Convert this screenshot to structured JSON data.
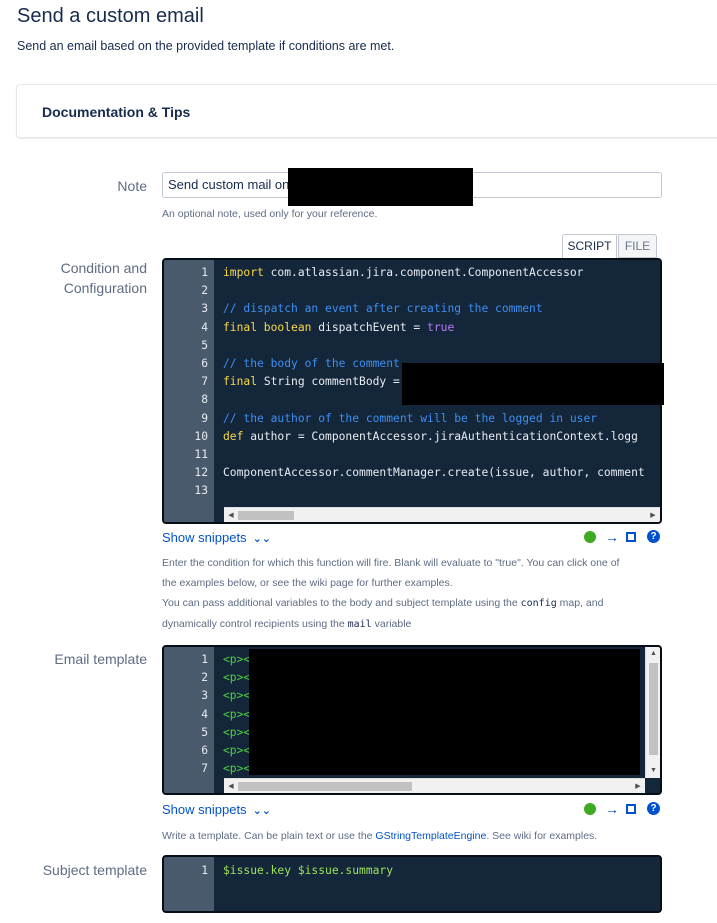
{
  "header": {
    "title": "Send a custom email",
    "description": "Send an email based on the provided template if conditions are met."
  },
  "doc_panel": {
    "title": "Documentation & Tips"
  },
  "note": {
    "label": "Note",
    "value": "Send custom mail on",
    "help": "An optional note, used only for your reference."
  },
  "condition": {
    "label_line1": "Condition and",
    "label_line2": "Configuration",
    "tabs": {
      "script": "SCRIPT",
      "file": "FILE"
    },
    "lines": [
      {
        "n": "1",
        "tokens": [
          {
            "t": "import ",
            "c": "kw"
          },
          {
            "t": "com.atlassian.jira.component.ComponentAccessor",
            "c": "pl"
          }
        ]
      },
      {
        "n": "2",
        "tokens": []
      },
      {
        "n": "3",
        "tokens": [
          {
            "t": "// dispatch an event after creating the comment",
            "c": "cm"
          }
        ]
      },
      {
        "n": "4",
        "tokens": [
          {
            "t": "final boolean ",
            "c": "kw"
          },
          {
            "t": "dispatchEvent = ",
            "c": "pl"
          },
          {
            "t": "true",
            "c": "bo"
          }
        ]
      },
      {
        "n": "5",
        "tokens": []
      },
      {
        "n": "6",
        "tokens": [
          {
            "t": "// the body of the comment",
            "c": "cm"
          }
        ]
      },
      {
        "n": "7",
        "tokens": [
          {
            "t": "final ",
            "c": "kw"
          },
          {
            "t": "String commentBody =",
            "c": "pl"
          }
        ]
      },
      {
        "n": "8",
        "tokens": []
      },
      {
        "n": "9",
        "tokens": [
          {
            "t": "// the author of the comment will be the logged in user",
            "c": "cm"
          }
        ]
      },
      {
        "n": "10",
        "tokens": [
          {
            "t": "def ",
            "c": "kw"
          },
          {
            "t": "author = ComponentAccessor.jiraAuthenticationContext.logg",
            "c": "pl"
          }
        ]
      },
      {
        "n": "11",
        "tokens": []
      },
      {
        "n": "12",
        "tokens": [
          {
            "t": "ComponentAccessor.commentManager.create(issue, author, comment",
            "c": "pl"
          }
        ]
      },
      {
        "n": "13",
        "tokens": []
      }
    ],
    "snippets_label": "Show snippets",
    "help_1": "Enter the condition for which this function will fire. Blank will evaluate to \"true\". You can click one of",
    "help_2": "the examples below, or see the wiki page for further examples.",
    "help_3a": "You can pass additional variables to the body and subject template using the ",
    "help_3_code": "config",
    "help_3b": " map, and",
    "help_4a": "dynamically control recipients using the ",
    "help_4_code": "mail",
    "help_4b": " variable"
  },
  "email_template": {
    "label": "Email template",
    "lines": [
      {
        "n": "1",
        "tokens": [
          {
            "t": "<p><",
            "c": "tg"
          }
        ]
      },
      {
        "n": "2",
        "tokens": [
          {
            "t": "<p><",
            "c": "tg"
          }
        ]
      },
      {
        "n": "3",
        "tokens": [
          {
            "t": "<p><",
            "c": "tg"
          }
        ]
      },
      {
        "n": "4",
        "tokens": [
          {
            "t": "<p><",
            "c": "tg"
          }
        ]
      },
      {
        "n": "5",
        "tokens": [
          {
            "t": "<p><",
            "c": "tg"
          }
        ]
      },
      {
        "n": "6",
        "tokens": [
          {
            "t": "<p><",
            "c": "tg"
          }
        ]
      },
      {
        "n": "7",
        "tokens": [
          {
            "t": "<p><",
            "c": "tg"
          }
        ]
      }
    ],
    "snippets_label": "Show snippets",
    "help_a": "Write a template. Can be plain text or use the ",
    "help_link": "GStringTemplateEngine",
    "help_b": ". See wiki for examples."
  },
  "subject_template": {
    "label": "Subject template",
    "lines": [
      {
        "n": "1",
        "tokens": [
          {
            "t": "$issue.key $issue.summary",
            "c": "vr"
          }
        ]
      }
    ]
  },
  "icons": {
    "ok": "green-dot-icon",
    "arrow": "arrow-right-icon",
    "fullscreen": "fullscreen-icon",
    "help": "question-icon",
    "help_text": "?",
    "arrow_glyph": "→",
    "chevron": "»"
  }
}
